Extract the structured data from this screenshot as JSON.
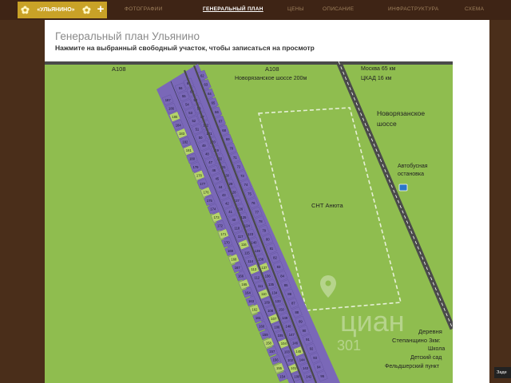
{
  "header": {
    "logo_text": "«УЛЬЯНИНО»",
    "plus": "+",
    "nav": [
      {
        "label": "ФОТОГРАФИИ",
        "active": false
      },
      {
        "label": "ГЕНЕРАЛЬНЫЙ ПЛАН",
        "active": true
      },
      {
        "label": "ЦЕНЫ",
        "active": false
      },
      {
        "label": "ОПИСАНИЕ",
        "active": false
      },
      {
        "label": "ИНФРАСТРУКТУРА",
        "active": false
      },
      {
        "label": "СХЕМА",
        "active": false
      }
    ]
  },
  "page": {
    "title": "Генеральный план Ульянино",
    "subtitle": "Нажмите на выбранный свободный участок, чтобы записаться на просмотр"
  },
  "map": {
    "road_a108_left": "А108",
    "road_a108_mid": "А108",
    "novoryazan_200": "Новорязанское шоссе 200м",
    "moscow": "Москва 65 км",
    "ckad": "ЦКАД 16 км",
    "highway_l1": "Новорязанское",
    "highway_l2": "шоссе",
    "bus_l1": "Автобусная",
    "bus_l2": "остановка",
    "snt": "СНТ Анюта",
    "village_l1": "Деревня",
    "village_l2": "Степанщино 3км:",
    "school": "Школа",
    "kindergarten": "Детский сад",
    "medpoint": "Фельдшерский пункт",
    "watermark": "циан",
    "watermark_num": "301",
    "colors": {
      "grass": "#8fbd4f",
      "plot": "#7a68b8",
      "plot_free": "#b5d36a",
      "road": "#4a4a4a"
    },
    "plots_left": [
      "187",
      "186",
      "185",
      "184",
      "183",
      "182",
      "181",
      "180",
      "179",
      "178",
      "177",
      "176",
      "175",
      "174",
      "173",
      "172",
      "171",
      "170",
      "169",
      "168",
      "167",
      "166",
      "165",
      "164",
      "163",
      "162",
      "161",
      "160",
      "159",
      "158",
      "157",
      "156",
      "155",
      "154"
    ],
    "plots_mid": [
      "56",
      "55",
      "54",
      "53",
      "52",
      "51",
      "50",
      "49",
      "48",
      "47",
      "46",
      "45",
      "44",
      "43",
      "42",
      "41",
      "40",
      "118",
      "117",
      "116",
      "115",
      "114",
      "113",
      "112",
      "111",
      "110",
      "109",
      "108",
      "107",
      "106",
      "105",
      "104",
      "103",
      "102",
      "101",
      "100"
    ],
    "plots_right": [
      "62",
      "63",
      "64",
      "65",
      "66",
      "67",
      "68",
      "69",
      "70",
      "71",
      "72",
      "73",
      "74",
      "75",
      "76",
      "77",
      "78",
      "79",
      "80",
      "81",
      "82",
      "83",
      "84",
      "85",
      "86",
      "87",
      "88",
      "89",
      "90",
      "91",
      "92",
      "93",
      "94",
      "95"
    ],
    "plots_inner": [
      "61",
      "60",
      "59",
      "58",
      "57",
      "122",
      "121",
      "120",
      "119",
      "132",
      "131",
      "130",
      "129",
      "128",
      "127",
      "126",
      "125",
      "124",
      "123",
      "140",
      "139",
      "138",
      "137",
      "136",
      "135",
      "134",
      "133",
      "150",
      "149",
      "148",
      "147",
      "146",
      "145",
      "144",
      "143",
      "142"
    ],
    "free_plots": [
      "185",
      "183",
      "181",
      "178",
      "176",
      "173",
      "171",
      "168",
      "165",
      "162",
      "158",
      "155",
      "116",
      "113",
      "110",
      "107",
      "104",
      "101",
      "145",
      "137"
    ]
  },
  "tooltip": "Заде"
}
